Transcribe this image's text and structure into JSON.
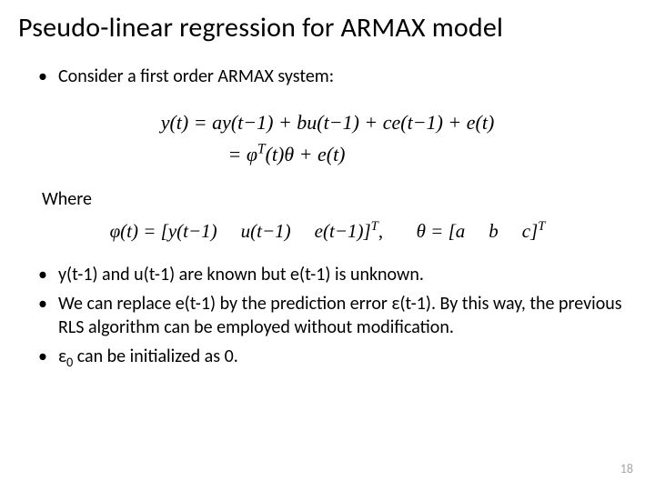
{
  "title": "Pseudo-linear regression for ARMAX model",
  "bullet1": "Consider a first order ARMAX system:",
  "eq1_line1": "y(t) = ay(t−1) + bu(t−1) + ce(t−1) + e(t)",
  "eq1_line2_prefix": "= φ",
  "eq1_line2_sup": "T",
  "eq1_line2_suffix": "(t)θ + e(t)",
  "where_label": "Where",
  "phi_prefix": "φ(t) = [y(t−1)",
  "phi_mid1": "u(t−1)",
  "phi_mid2": "e(t−1)]",
  "phi_sup": "T",
  "phi_comma": ",",
  "theta_prefix": "θ = [a",
  "theta_mid1": "b",
  "theta_mid2": "c]",
  "theta_sup": "T",
  "bullet2": "y(t-1) and u(t-1) are known but e(t-1) is unknown.",
  "bullet3": "We can replace e(t-1) by the prediction error ε(t-1). By this way, the previous RLS algorithm can be employed without modification.",
  "bullet4_prefix": "ε",
  "bullet4_sub": "0",
  "bullet4_suffix": " can be initialized as 0.",
  "page_number": "18"
}
